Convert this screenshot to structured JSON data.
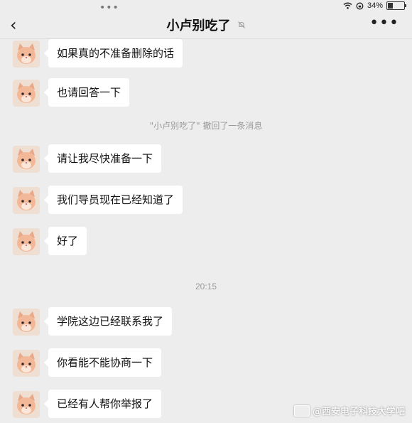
{
  "status": {
    "battery": "34%",
    "battery_level": 0.34
  },
  "header": {
    "title": "小卢别吃了"
  },
  "messages": [
    {
      "text": "如果真的不准备删除的话"
    },
    {
      "text": "也请回答一下"
    },
    {
      "text": "请让我尽快准备一下"
    },
    {
      "text": "我们导员现在已经知道了"
    },
    {
      "text": "好了"
    },
    {
      "text": "学院这边已经联系我了"
    },
    {
      "text": "你看能不能协商一下"
    },
    {
      "text": "已经有人帮你举报了"
    }
  ],
  "notice": {
    "text": "\"小卢别吃了\" 撤回了一条消息"
  },
  "timestamp": "20:15",
  "watermark": "@西安电子科技大学吧",
  "colors": {
    "background": "#ededed",
    "bubble": "#ffffff",
    "system_text": "#9a9a9a"
  }
}
